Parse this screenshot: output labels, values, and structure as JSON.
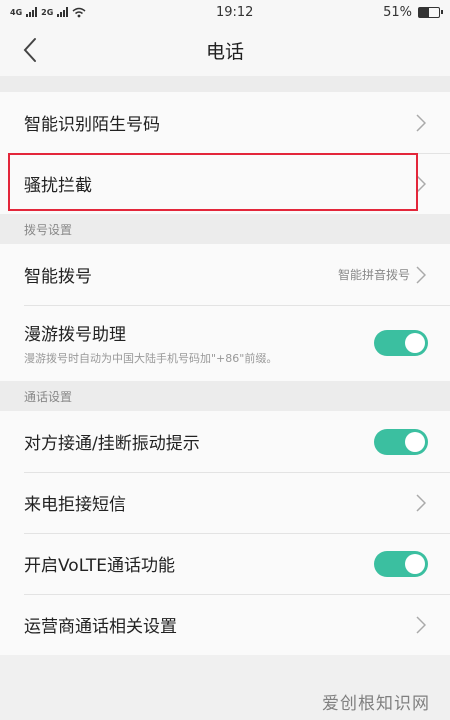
{
  "status_bar": {
    "network_left": "4G",
    "network_right": "2G",
    "time": "19:12",
    "battery_text": "51%",
    "battery_level": 0.51
  },
  "header": {
    "title": "电话"
  },
  "group1": {
    "items": [
      {
        "label": "智能识别陌生号码"
      },
      {
        "label": "骚扰拦截"
      }
    ]
  },
  "dial_section": {
    "header": "拨号设置",
    "smart_dial": {
      "label": "智能拨号",
      "value": "智能拼音拨号"
    },
    "roaming": {
      "label": "漫游拨号助理",
      "sub": "漫游拨号时自动为中国大陆手机号码加\"+86\"前缀。",
      "enabled": true
    }
  },
  "call_section": {
    "header": "通话设置",
    "vibrate": {
      "label": "对方接通/挂断振动提示",
      "enabled": true
    },
    "reject_sms": {
      "label": "来电拒接短信"
    },
    "volte": {
      "label": "开启VoLTE通话功能",
      "enabled": true
    },
    "carrier": {
      "label": "运营商通话相关设置"
    }
  },
  "watermark": "爱创根知识网",
  "colors": {
    "toggle_on": "#3bbfa0",
    "highlight": "#e3263a"
  }
}
